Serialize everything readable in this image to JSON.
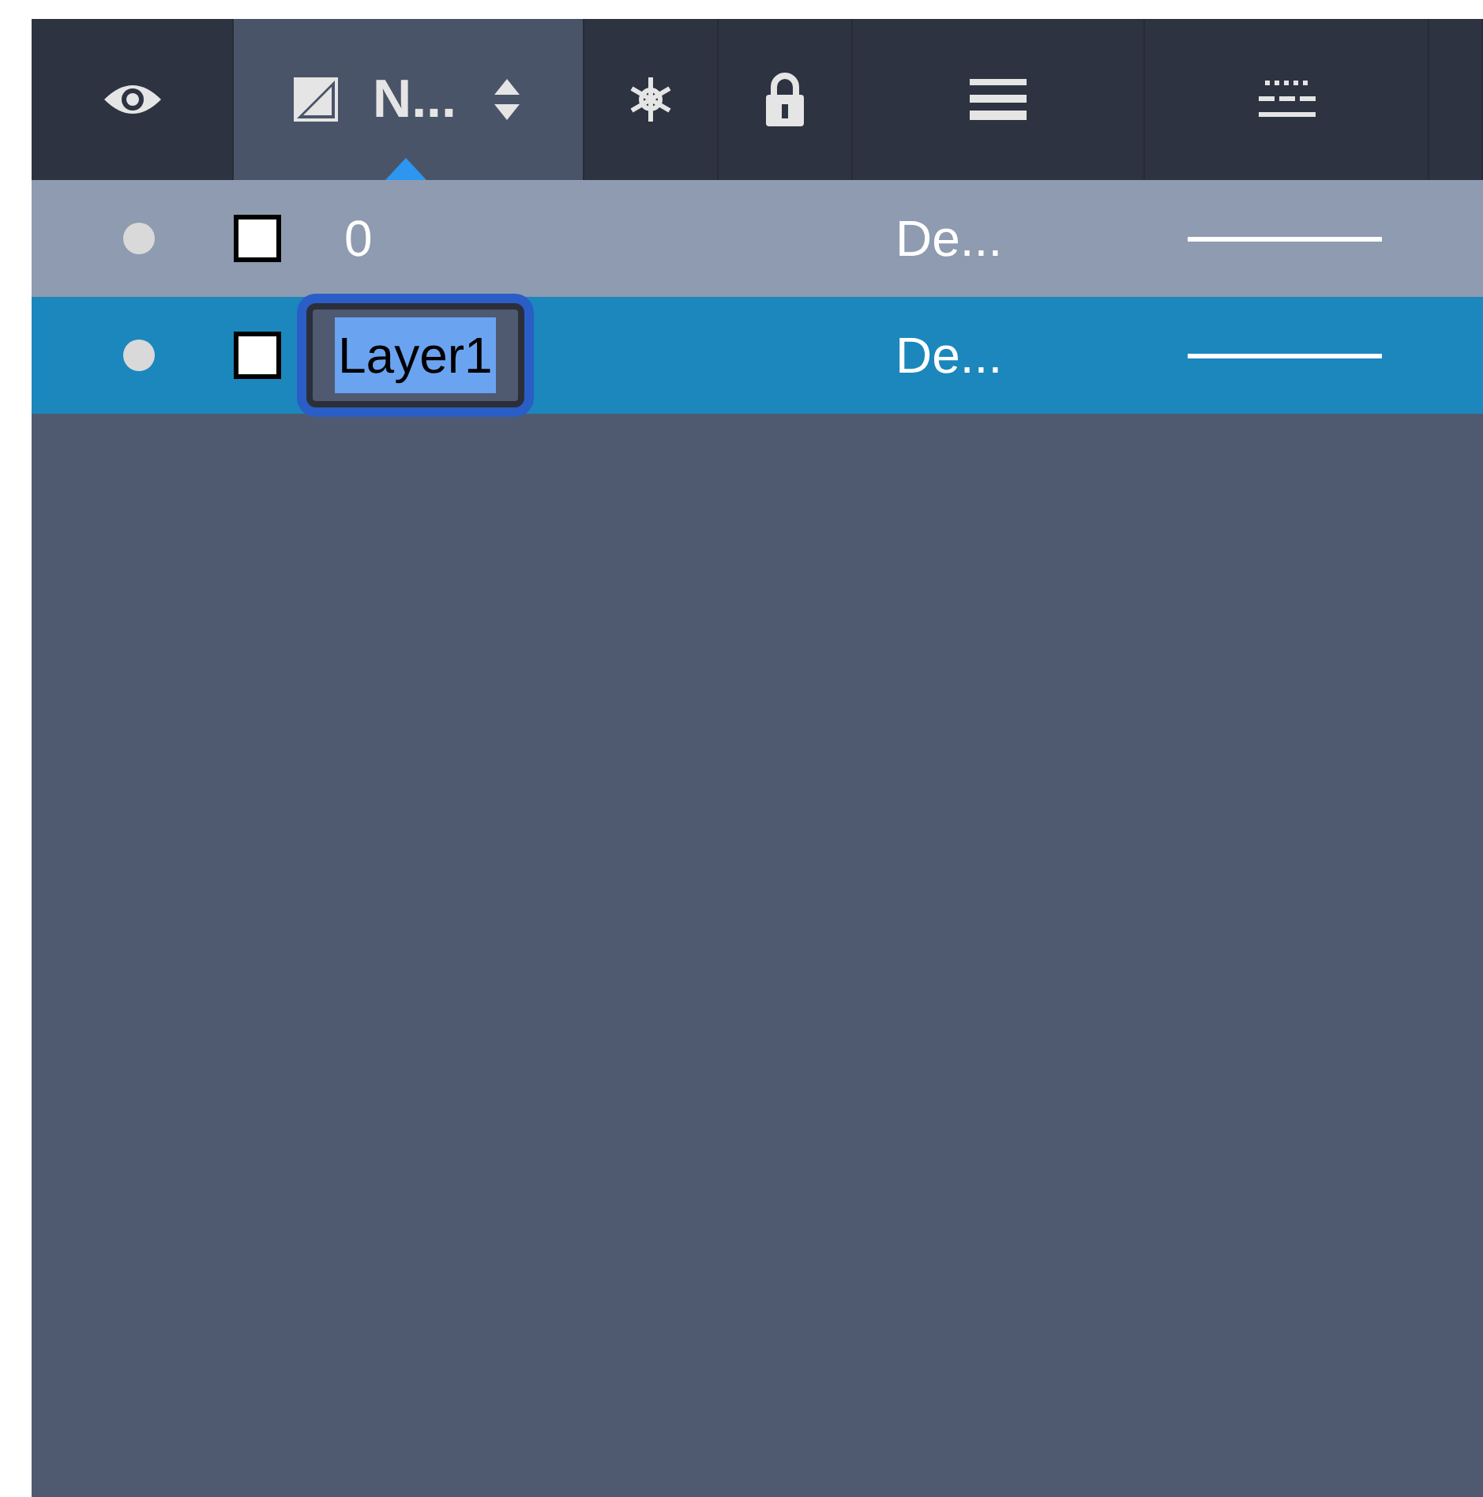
{
  "header": [
    {
      "kind": "visibility",
      "selected": false
    },
    {
      "kind": "name",
      "label": "N...",
      "selected": true
    },
    {
      "kind": "freeze",
      "selected": false
    },
    {
      "kind": "lock",
      "selected": false
    },
    {
      "kind": "lineweight",
      "selected": false
    },
    {
      "kind": "linetype",
      "selected": false
    },
    {
      "kind": "more",
      "selected": false
    }
  ],
  "rows": [
    {
      "on": true,
      "color": "#ffffff",
      "name": "0",
      "editing": false,
      "selected": false,
      "column_3": "De..."
    },
    {
      "on": true,
      "color": "#ffffff",
      "name": "Layer1",
      "editing": true,
      "selected": true,
      "column_3": "De..."
    }
  ]
}
